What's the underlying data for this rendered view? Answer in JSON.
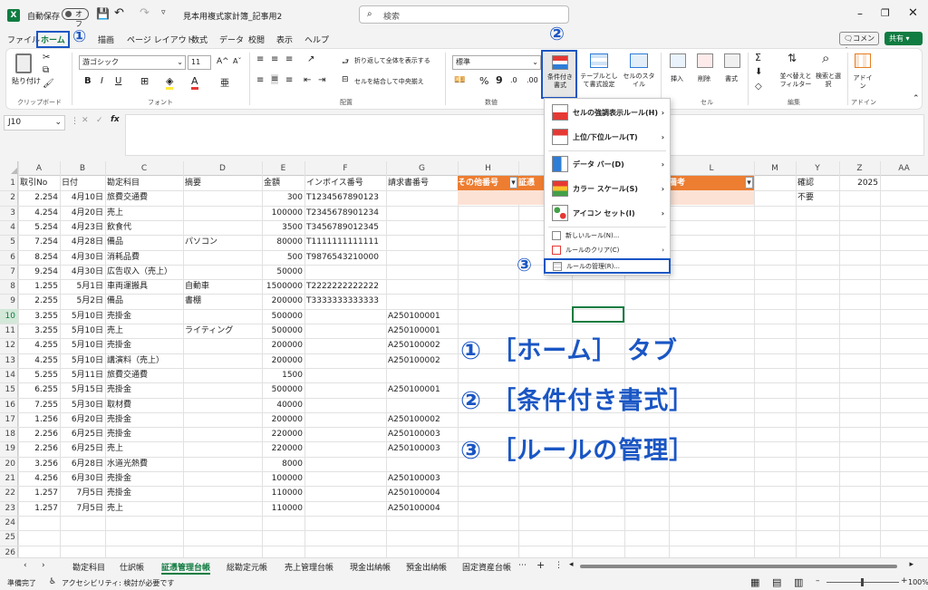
{
  "title": {
    "autosave": "自動保存",
    "autosave_state": "オフ",
    "filename": "見本用複式家計簿_記事用2",
    "search_placeholder": "検索"
  },
  "menu": {
    "items": [
      "ファイル",
      "ホーム",
      "描画",
      "ページ レイアウト",
      "数式",
      "データ",
      "校閲",
      "表示",
      "ヘルプ"
    ],
    "comment": "コメント",
    "share": "共有"
  },
  "ribbon": {
    "paste": "貼り付け",
    "clipboard": "クリップボード",
    "font_name": "游ゴシック",
    "font_size": "11",
    "font_group": "フォント",
    "wrap": "折り返して全体を表示する",
    "merge": "セルを結合して中央揃え",
    "align_group": "配置",
    "number_format": "標準",
    "number_group": "数値",
    "cond_format": "条件付き書式",
    "table_format": "テーブルとして書式設定",
    "cell_style": "セルのスタイル",
    "insert": "挿入",
    "delete": "削除",
    "format": "書式",
    "cells_group": "セル",
    "sort": "並べ替えとフィルター",
    "find": "検索と選択",
    "edit_group": "編集",
    "addin": "アドイン",
    "addin_group": "アドイン"
  },
  "namebox": "J10",
  "dropdown": {
    "items": [
      "セルの強調表示ルール(H)",
      "上位/下位ルール(T)",
      "データ バー(D)",
      "カラー スケール(S)",
      "アイコン セット(I)"
    ],
    "new_rule": "新しいルール(N)...",
    "clear_rule": "ルールのクリア(C)",
    "manage_rule": "ルールの管理(R)..."
  },
  "markers": {
    "m1": "①",
    "m2": "②",
    "m3": "③"
  },
  "annotations": [
    "① ［ホーム］ タブ",
    "② ［条件付き書式］",
    "③ ［ルールの管理］"
  ],
  "columns": [
    "A",
    "B",
    "C",
    "D",
    "E",
    "F",
    "G",
    "H",
    "L",
    "M",
    "Y",
    "Z",
    "AA"
  ],
  "headers": {
    "A": "取引No",
    "B": "日付",
    "C": "勘定科目",
    "D": "摘要",
    "E": "金額",
    "F": "インボイス番号",
    "G": "請求書番号",
    "H": "その他番号",
    "I": "証憑",
    "L": "備考",
    "Y": "確認",
    "Z": "2025"
  },
  "y2": "不要",
  "rows": [
    [
      "2.254",
      "4月10日",
      "旅費交通費",
      "",
      "300",
      "T1234567890123",
      ""
    ],
    [
      "4.254",
      "4月20日",
      "売上",
      "",
      "100000",
      "T2345678901234",
      ""
    ],
    [
      "5.254",
      "4月23日",
      "飲食代",
      "",
      "3500",
      "T3456789012345",
      ""
    ],
    [
      "7.254",
      "4月28日",
      "備品",
      "パソコン",
      "80000",
      "T1111111111111",
      ""
    ],
    [
      "8.254",
      "4月30日",
      "消耗品費",
      "",
      "500",
      "T9876543210000",
      ""
    ],
    [
      "9.254",
      "4月30日",
      "広告収入（売上）",
      "",
      "50000",
      "",
      ""
    ],
    [
      "1.255",
      "5月1日",
      "車両運搬具",
      "自動車",
      "1500000",
      "T2222222222222",
      ""
    ],
    [
      "2.255",
      "5月2日",
      "備品",
      "書棚",
      "200000",
      "T3333333333333",
      ""
    ],
    [
      "3.255",
      "5月10日",
      "売掛金",
      "",
      "500000",
      "",
      "A250100001"
    ],
    [
      "3.255",
      "5月10日",
      "売上",
      "ライティング",
      "500000",
      "",
      "A250100001"
    ],
    [
      "4.255",
      "5月10日",
      "売掛金",
      "",
      "200000",
      "",
      "A250100002"
    ],
    [
      "4.255",
      "5月10日",
      "講演料（売上）",
      "",
      "200000",
      "",
      "A250100002"
    ],
    [
      "5.255",
      "5月11日",
      "旅費交通費",
      "",
      "1500",
      "",
      ""
    ],
    [
      "6.255",
      "5月15日",
      "売掛金",
      "",
      "500000",
      "",
      "A250100001"
    ],
    [
      "7.255",
      "5月30日",
      "取材費",
      "",
      "40000",
      "",
      ""
    ],
    [
      "1.256",
      "6月20日",
      "売掛金",
      "",
      "200000",
      "",
      "A250100002"
    ],
    [
      "2.256",
      "6月25日",
      "売掛金",
      "",
      "220000",
      "",
      "A250100003"
    ],
    [
      "2.256",
      "6月25日",
      "売上",
      "",
      "220000",
      "",
      "A250100003"
    ],
    [
      "3.256",
      "6月28日",
      "水道光熱費",
      "",
      "8000",
      "",
      ""
    ],
    [
      "4.256",
      "6月30日",
      "売掛金",
      "",
      "100000",
      "",
      "A250100003"
    ],
    [
      "1.257",
      "7月5日",
      "売掛金",
      "",
      "110000",
      "",
      "A250100004"
    ],
    [
      "1.257",
      "7月5日",
      "売上",
      "",
      "110000",
      "",
      "A250100004"
    ]
  ],
  "sheet_tabs": [
    "勘定科目",
    "仕訳帳",
    "証憑管理台帳",
    "総勘定元帳",
    "売上管理台帳",
    "現金出納帳",
    "預金出納帳",
    "固定資産台帳"
  ],
  "active_tab": "証憑管理台帳",
  "status": {
    "ready": "準備完了",
    "access": "アクセシビリティ: 検討が必要です",
    "zoom": "100%"
  }
}
